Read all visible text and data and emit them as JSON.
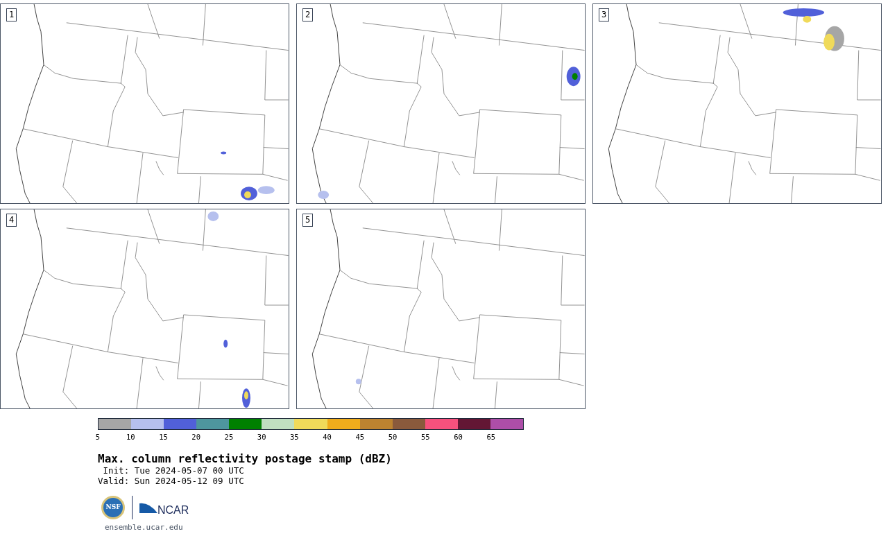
{
  "panels": [
    {
      "label": "1"
    },
    {
      "label": "2"
    },
    {
      "label": "3"
    },
    {
      "label": "4"
    },
    {
      "label": "5"
    }
  ],
  "colorbar": {
    "segments": [
      {
        "color": "#a6a6a6"
      },
      {
        "color": "#b6c0ee"
      },
      {
        "color": "#5160d9"
      },
      {
        "color": "#4e969e"
      },
      {
        "color": "#008000"
      },
      {
        "color": "#c0dfc0"
      },
      {
        "color": "#f0da5a"
      },
      {
        "color": "#efac1c"
      },
      {
        "color": "#bd8330"
      },
      {
        "color": "#8a5a3c"
      },
      {
        "color": "#f7517d"
      },
      {
        "color": "#631634"
      },
      {
        "color": "#ad4ea8"
      }
    ],
    "ticks": [
      "5",
      "10",
      "15",
      "20",
      "25",
      "30",
      "35",
      "40",
      "45",
      "50",
      "55",
      "60",
      "65"
    ]
  },
  "title": "Max. column reflectivity postage stamp (dBZ)",
  "init": " Init: Tue 2024-05-07 00 UTC",
  "valid": "Valid: Sun 2024-05-12 09 UTC",
  "logo": {
    "nsf": "NSF",
    "ncar": "NCAR"
  },
  "url": "ensemble.ucar.edu"
}
